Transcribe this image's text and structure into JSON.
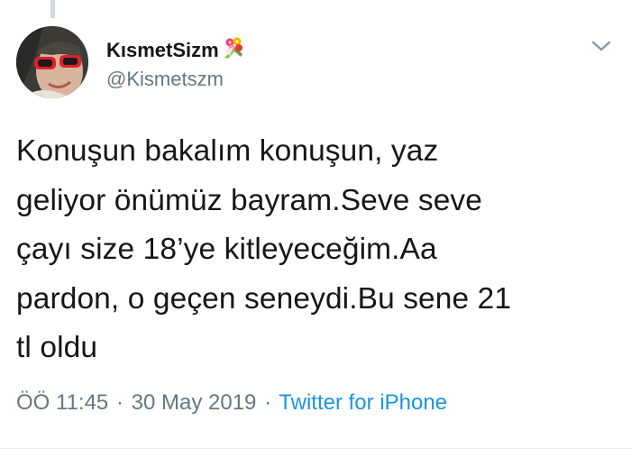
{
  "author": {
    "display_name": "KısmetSizm",
    "name_emoji": "bouquet-icon",
    "handle": "@Kismetszm",
    "avatar": "avatar-photo"
  },
  "tweet": {
    "lines": [
      "Konuşun bakalım konuşun, yaz",
      "geliyor önümüz bayram.Seve seve",
      "çayı size 18’ye kitleyeceğim.Aa",
      "pardon, o geçen seneydi.Bu sene 21",
      "tl oldu"
    ]
  },
  "meta": {
    "time": "ÖÖ 11:45",
    "separator": "·",
    "date": "30 May 2019",
    "source": "Twitter for iPhone"
  },
  "icons": {
    "menu": "chevron-down-icon"
  },
  "colors": {
    "text": "#14171a",
    "secondary": "#657786",
    "link": "#1b95e0",
    "background": "#ffffff"
  }
}
